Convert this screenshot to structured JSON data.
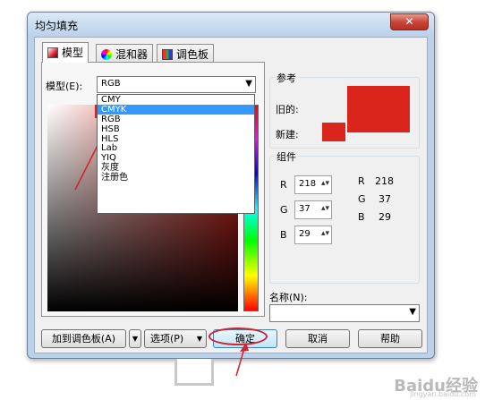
{
  "window": {
    "title": "均匀填充",
    "close_glyph": "✕"
  },
  "tabs": [
    {
      "label": "模型",
      "icon": "model-swatch-icon"
    },
    {
      "label": "混和器",
      "icon": "color-wheel-icon"
    },
    {
      "label": "调色板",
      "icon": "palette-grid-icon"
    }
  ],
  "model_field": {
    "label": "模型(E):",
    "value": "RGB",
    "options": [
      "CMY",
      "CMYK",
      "RGB",
      "HSB",
      "HLS",
      "Lab",
      "YIQ",
      "灰度",
      "注册色"
    ],
    "highlighted": "CMYK"
  },
  "reference": {
    "title": "参考",
    "old_label": "旧的:",
    "new_label": "新建:",
    "old_color": "#da251d",
    "new_color": "#da251d"
  },
  "components": {
    "title": "组件",
    "inputs": [
      {
        "label": "R",
        "value": "218"
      },
      {
        "label": "G",
        "value": "37"
      },
      {
        "label": "B",
        "value": "29"
      }
    ],
    "readouts": [
      {
        "label": "R",
        "value": "218"
      },
      {
        "label": "G",
        "value": "37"
      },
      {
        "label": "B",
        "value": "29"
      }
    ]
  },
  "name_field": {
    "label": "名称(N):",
    "value": ""
  },
  "buttons": {
    "add_palette": "加到调色板(A)",
    "options": "选项(P)",
    "ok": "确定",
    "cancel": "取消",
    "help": "帮助"
  },
  "watermark": {
    "text": "Baidu经验",
    "sub": "jingyan.baidu.com"
  },
  "annotation_color": "#d2232a"
}
